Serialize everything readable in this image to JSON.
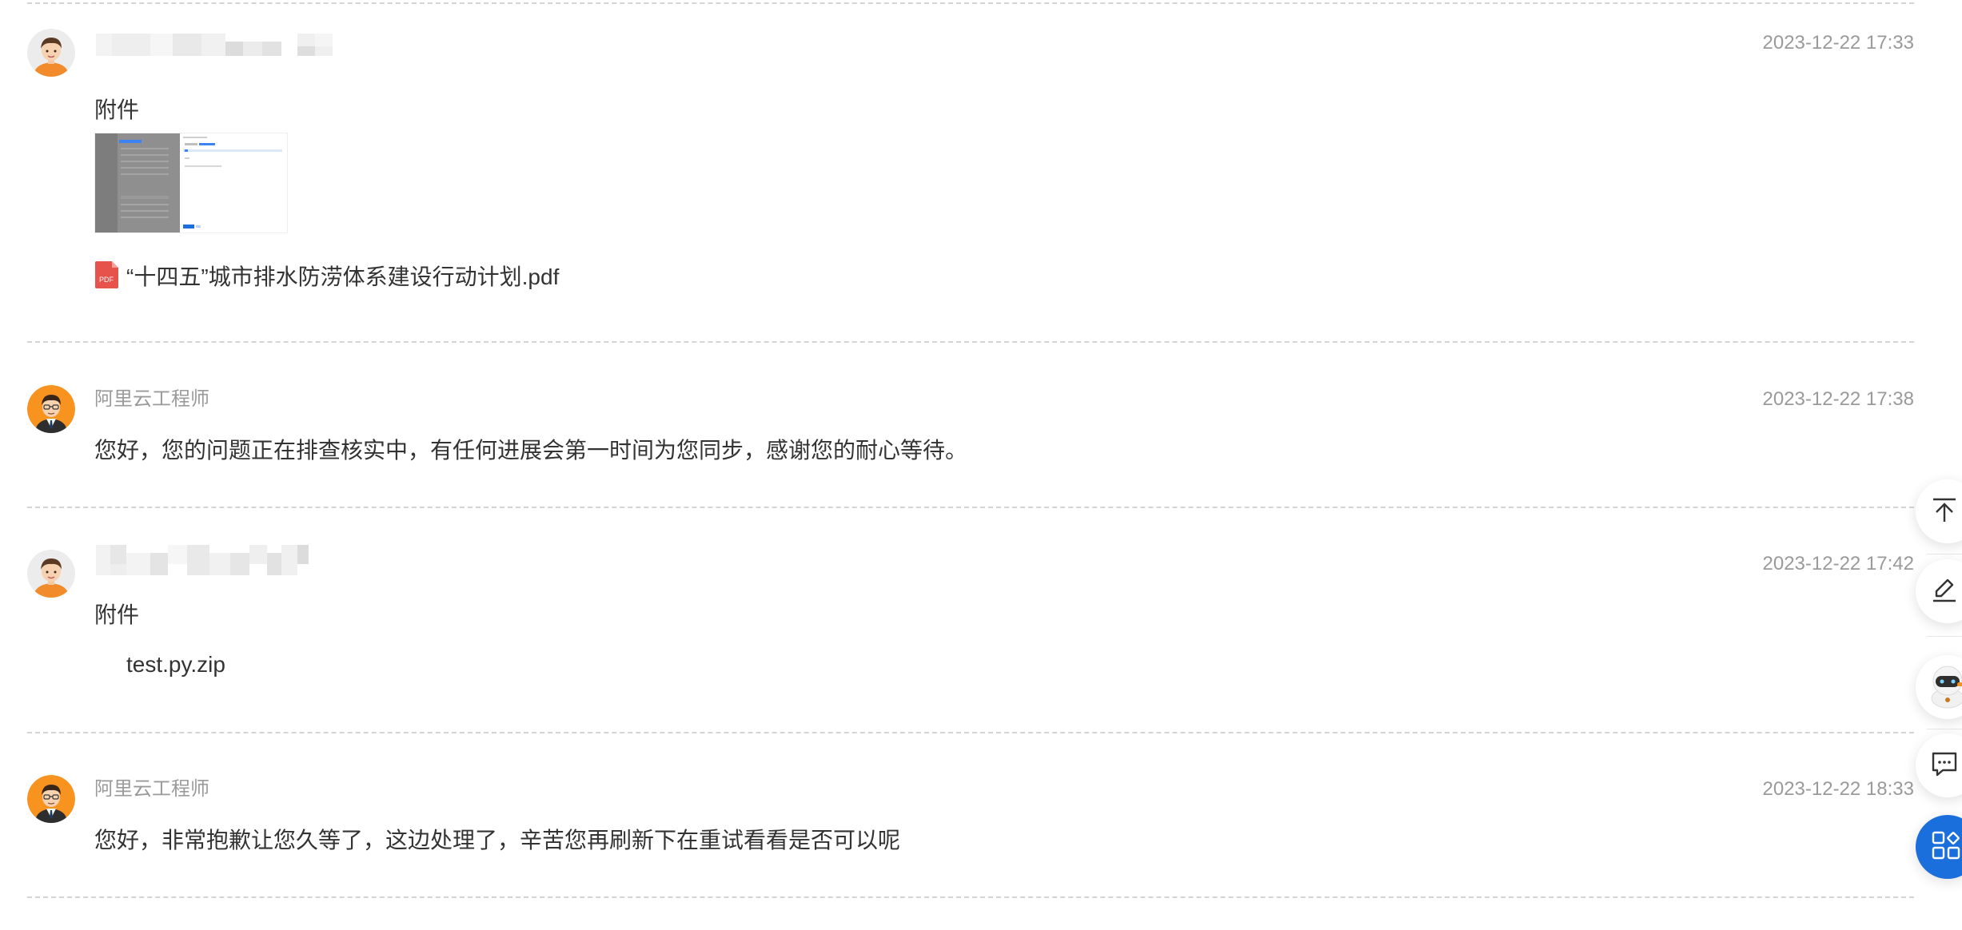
{
  "messages": [
    {
      "author": "",
      "author_redacted": true,
      "avatar": "user-avatar",
      "time": "2023-12-22 17:33",
      "attachment_label": "附件",
      "image_attachment": "screenshot-thumbnail",
      "file": {
        "icon": "pdf-icon",
        "icon_text": "PDF",
        "name": "“十四五”城市排水防涝体系建设行动计划.pdf"
      }
    },
    {
      "author": "阿里云工程师",
      "avatar": "engineer-avatar",
      "time": "2023-12-22 17:38",
      "text": "您好，您的问题正在排查核实中，有任何进展会第一时间为您同步，感谢您的耐心等待。"
    },
    {
      "author": "",
      "author_redacted": true,
      "avatar": "user-avatar",
      "time": "2023-12-22 17:42",
      "attachment_label": "附件",
      "file": {
        "name": "test.py.zip"
      }
    },
    {
      "author": "阿里云工程师",
      "avatar": "engineer-avatar",
      "time": "2023-12-22 18:33",
      "text": "您好，非常抱歉让您久等了，这边处理了，辛苦您再刷新下在重试看看是否可以呢"
    }
  ],
  "floating_toolbar": [
    {
      "icon": "back-to-top-icon"
    },
    {
      "icon": "edit-icon"
    },
    {
      "icon": "assistant-robot-icon"
    },
    {
      "icon": "feedback-chat-icon"
    },
    {
      "icon": "apps-grid-icon"
    }
  ],
  "colors": {
    "accent": "#1a6fdc",
    "pdf": "#e5534b",
    "avatar_orange": "#f7931e",
    "muted_text": "#9a9a9a"
  }
}
